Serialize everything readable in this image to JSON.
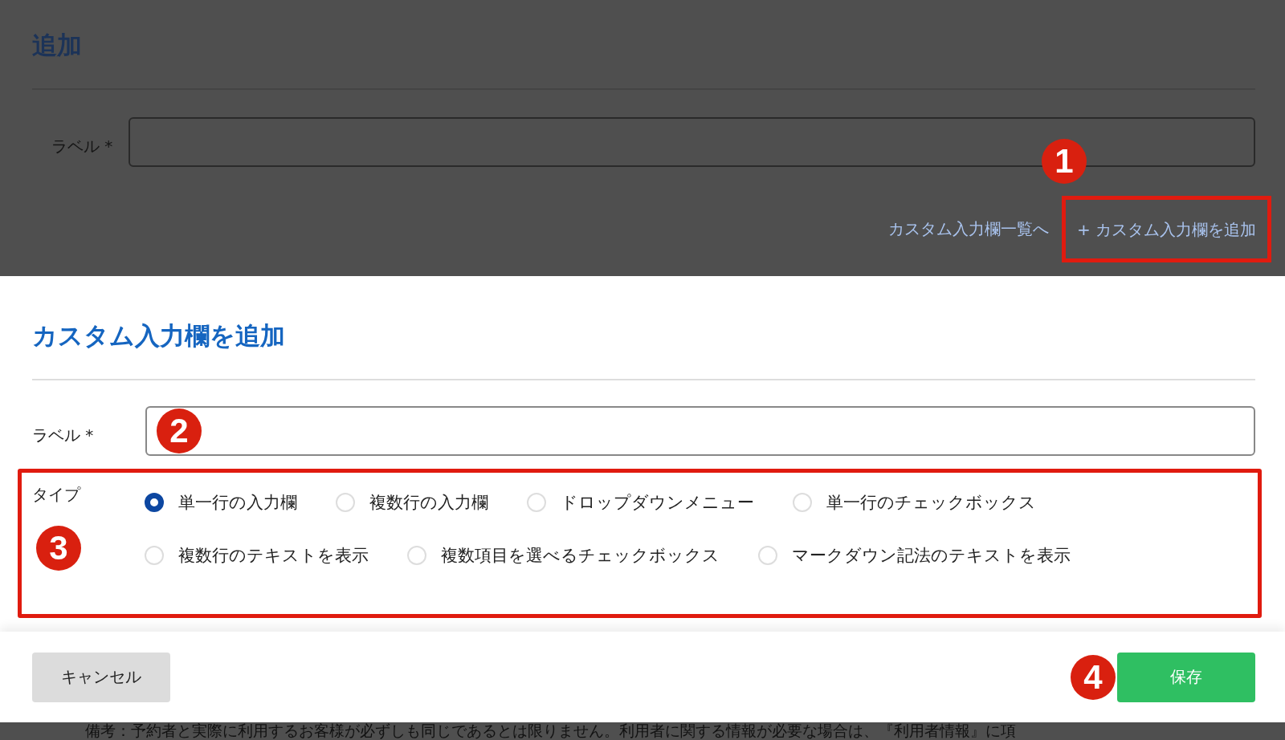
{
  "background_page": {
    "title": "追加",
    "label_field": {
      "label": "ラベル *"
    },
    "links": [
      {
        "text": "カスタム入力欄一覧へ",
        "highlighted": false
      },
      {
        "text": "+ カスタム入力欄を追加",
        "highlighted": true,
        "callout": "1"
      }
    ],
    "note": "備考：予約者と実際に利用するお客様が必ずしも同じであるとは限りません。利用者に関する情報が必要な場合は、『利用者情報』に項"
  },
  "dialog": {
    "title": "カスタム入力欄を追加",
    "label_field": {
      "label": "ラベル *",
      "callout": "2"
    },
    "type_group": {
      "label": "タイプ",
      "highlighted": true,
      "callout": "3",
      "option_rows": [
        [
          {
            "label": "単一行の入力欄",
            "selected": true
          },
          {
            "label": "複数行の入力欄",
            "selected": false
          },
          {
            "label": "ドロップダウンメニュー",
            "selected": false
          },
          {
            "label": "単一行のチェックボックス",
            "selected": false
          }
        ],
        [
          {
            "label": "複数行のテキストを表示",
            "selected": false
          },
          {
            "label": "複数項目を選べるチェックボックス",
            "selected": false
          },
          {
            "label": "マークダウン記法のテキストを表示",
            "selected": false
          }
        ]
      ]
    },
    "buttons": [
      {
        "kind": "cancel",
        "label": "キャンセル"
      },
      {
        "kind": "save",
        "label": "保存",
        "callout": "4"
      }
    ]
  }
}
